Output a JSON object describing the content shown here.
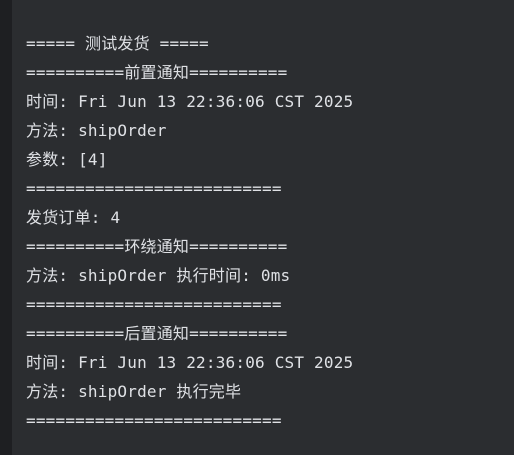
{
  "console": {
    "lines": [
      "===== 测试发货 =====",
      "==========前置通知==========",
      "时间: Fri Jun 13 22:36:06 CST 2025",
      "方法: shipOrder",
      "参数: [4]",
      "==========================",
      "发货订单: 4",
      "==========环绕通知==========",
      "方法: shipOrder 执行时间: 0ms",
      "==========================",
      "==========后置通知==========",
      "时间: Fri Jun 13 22:36:06 CST 2025",
      "方法: shipOrder 执行完毕",
      "=========================="
    ]
  },
  "colors": {
    "background": "#2b2d30",
    "gutter": "#1e1f22",
    "text": "#dfe1e5"
  }
}
